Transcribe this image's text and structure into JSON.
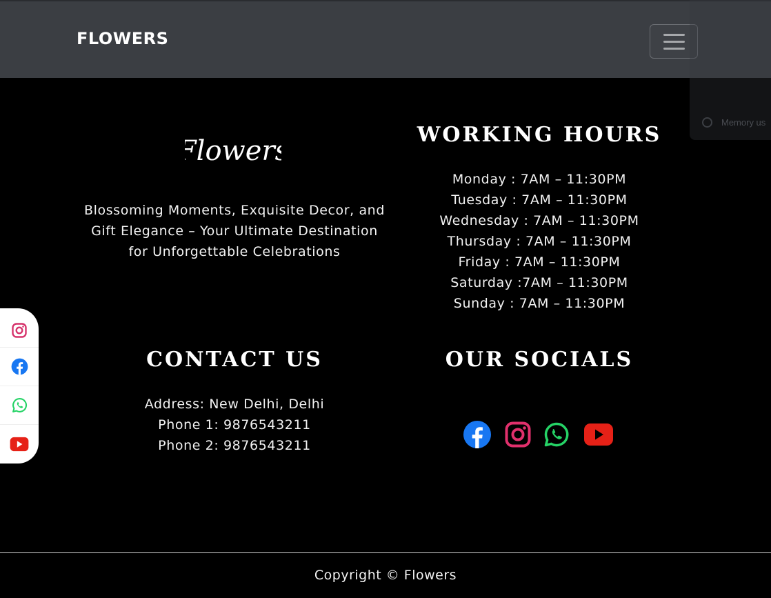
{
  "navbar": {
    "brand": "FLOWERS",
    "toggle_icon": "hamburger-icon"
  },
  "background_overlay": {
    "text": "Memory us"
  },
  "about": {
    "logo_text": "Flowers",
    "tagline_lines": [
      "Blossoming Moments, Exquisite Decor, and",
      "Gift Elegance – Your Ultimate Destination",
      "for Unforgettable Celebrations"
    ]
  },
  "working_hours": {
    "title": "WORKING HOURS",
    "rows": [
      "Monday : 7AM – 11:30PM",
      "Tuesday : 7AM – 11:30PM",
      "Wednesday : 7AM – 11:30PM",
      "Thursday : 7AM – 11:30PM",
      "Friday : 7AM – 11:30PM",
      "Saturday :7AM – 11:30PM",
      "Sunday : 7AM – 11:30PM"
    ]
  },
  "contact": {
    "title": "CONTACT US",
    "address": "Address: New Delhi, Delhi",
    "phone1": "Phone 1: 9876543211",
    "phone2": "Phone 2: 9876543211"
  },
  "socials": {
    "title": "OUR SOCIALS",
    "icons": [
      "facebook-icon",
      "instagram-icon",
      "whatsapp-icon",
      "youtube-icon"
    ]
  },
  "side_bar": {
    "icons": [
      "instagram-icon",
      "facebook-icon",
      "whatsapp-icon",
      "youtube-icon"
    ]
  },
  "footer": {
    "copyright": "Copyright © Flowers"
  },
  "colors": {
    "navbar_bg": "#3b3e43",
    "page_bg": "#000000",
    "facebook": "#1877f2",
    "instagram": "#e1306c",
    "whatsapp": "#25d366",
    "youtube": "#e62117"
  }
}
